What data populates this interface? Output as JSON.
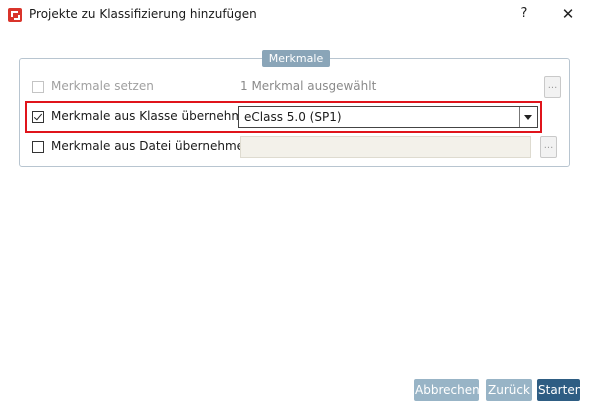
{
  "window": {
    "title": "Projekte zu Klassifizierung hinzufügen",
    "help_label": "?",
    "close_label": "✕"
  },
  "group": {
    "title": "Merkmale"
  },
  "rows": {
    "set": {
      "label": "Merkmale setzen",
      "value": "1 Merkmal ausgewählt",
      "checked": false,
      "enabled": false,
      "button_label": "..."
    },
    "class": {
      "label": "Merkmale aus Klasse übernehmen",
      "selected": "eClass 5.0 (SP1)",
      "checked": true,
      "enabled": true
    },
    "file": {
      "label": "Merkmale aus Datei übernehmen",
      "value": "",
      "checked": false,
      "enabled": true,
      "button_label": "..."
    }
  },
  "footer": {
    "cancel_label": "Abbrechen",
    "back_label": "Zurück",
    "start_label": "Starten"
  },
  "colors": {
    "highlight": "#e0141b",
    "primary": "#2e5d83",
    "disabled_button": "#98b4c6",
    "group_title_bg": "#8aa5b8"
  }
}
